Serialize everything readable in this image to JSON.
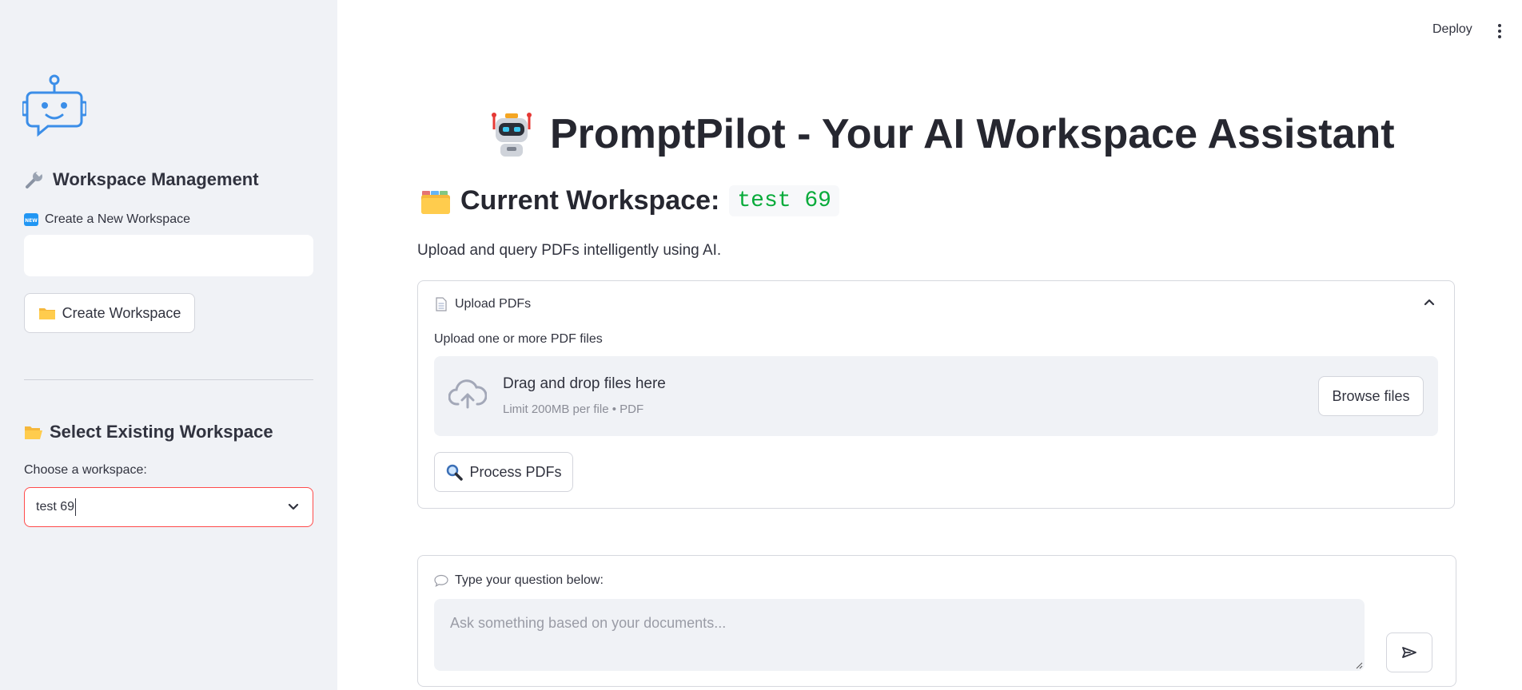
{
  "topbar": {
    "deploy_label": "Deploy"
  },
  "sidebar": {
    "management_heading": "Workspace Management",
    "management_icon": "wrench-icon",
    "create_label": "Create a New Workspace",
    "create_input_value": "",
    "create_button_label": "Create Workspace",
    "select_heading": "Select Existing Workspace",
    "select_label": "Choose a workspace:",
    "select_value": "test 69"
  },
  "main": {
    "title": "PromptPilot - Your AI Workspace Assistant",
    "workspace_label": "Current Workspace:",
    "workspace_name": "test 69",
    "description": "Upload and query PDFs intelligently using AI.",
    "upload": {
      "header": "Upload PDFs",
      "label": "Upload one or more PDF files",
      "drop_text": "Drag and drop files here",
      "limit_text": "Limit 200MB per file • PDF",
      "browse_label": "Browse files",
      "process_label": "Process PDFs"
    },
    "chat": {
      "label": "Type your question below:",
      "placeholder": "Ask something based on your documents..."
    }
  },
  "colors": {
    "sidebar_bg": "#f0f2f6",
    "accent_red": "#ff4b4b",
    "code_green": "#09ab3b",
    "text": "#31333f"
  }
}
